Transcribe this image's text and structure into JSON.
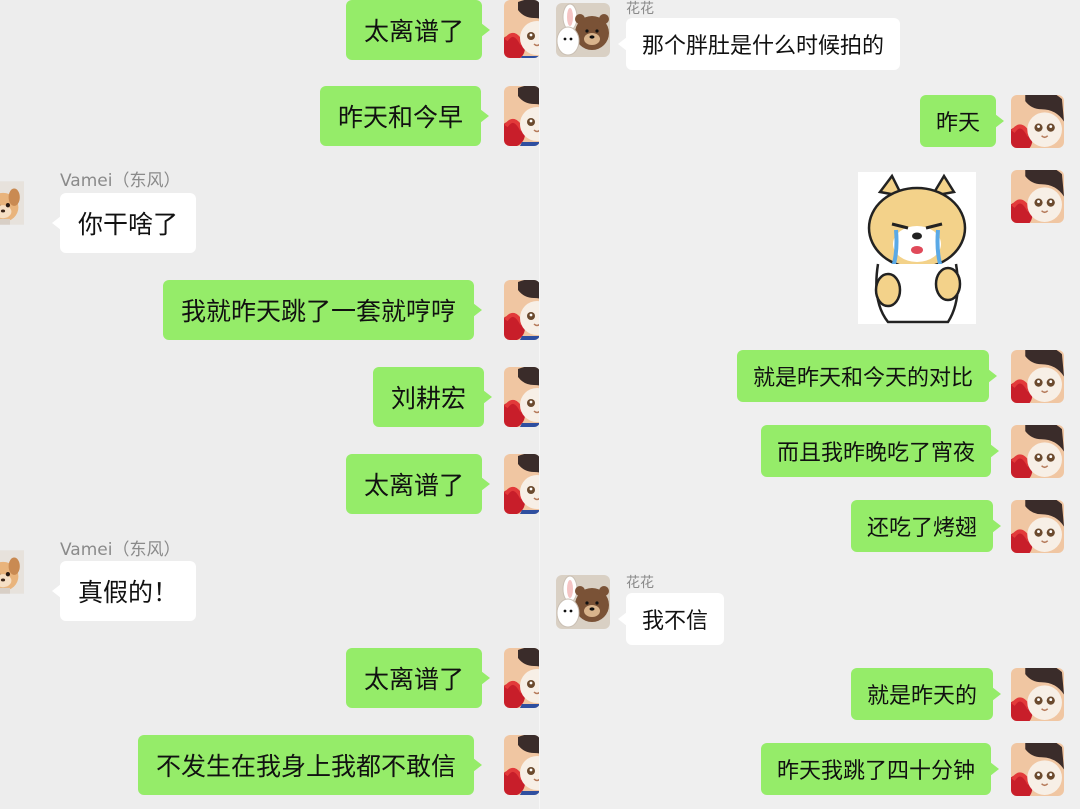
{
  "left_chat": {
    "other_name": "Vamei（东风）",
    "messages": [
      {
        "text": "太离谱了"
      },
      {
        "text": "昨天和今早"
      },
      {
        "text": "你干啥了"
      },
      {
        "text": "我就昨天跳了一套就哼哼"
      },
      {
        "text": "刘耕宏"
      },
      {
        "text": "太离谱了"
      },
      {
        "text": "真假的！"
      },
      {
        "text": "太离谱了"
      },
      {
        "text": "不发生在我身上我都不敢信"
      }
    ]
  },
  "right_chat": {
    "other_name": "花花",
    "messages": [
      {
        "text": "那个胖肚是什么时候拍的"
      },
      {
        "text": "昨天"
      },
      {
        "text": "就是昨天和今天的对比"
      },
      {
        "text": "而且我昨晚吃了宵夜"
      },
      {
        "text": "还吃了烤翅"
      },
      {
        "text": "我不信"
      },
      {
        "text": "就是昨天的"
      },
      {
        "text": "昨天我跳了四十分钟"
      }
    ]
  },
  "colors": {
    "my_bubble": "#95ec69",
    "other_bubble": "#ffffff",
    "background": "#ededed",
    "sender_name": "#8a8a8a"
  },
  "icons": {
    "my_avatar": "cartoon-cat-avatar-icon",
    "left_other_avatar": "puppy-avatar-icon",
    "right_other_avatar": "bear-and-bunny-avatar-icon",
    "sticker": "crying-shiba-sticker-icon"
  }
}
